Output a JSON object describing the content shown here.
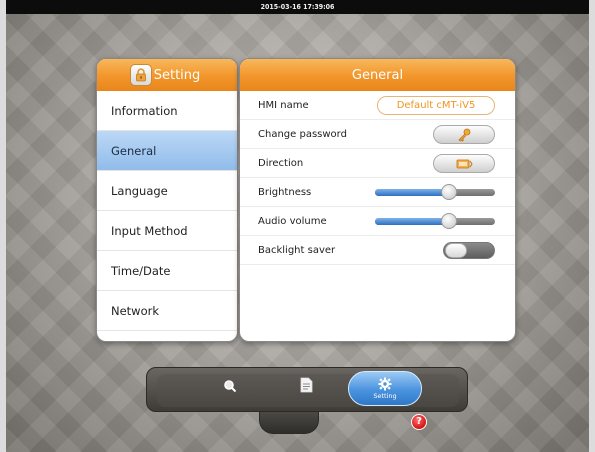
{
  "status_bar": {
    "datetime": "2015-03-16 17:39:06"
  },
  "left_panel": {
    "title": "Setting",
    "items": [
      {
        "label": "Information"
      },
      {
        "label": "General",
        "selected": true
      },
      {
        "label": "Language"
      },
      {
        "label": "Input Method"
      },
      {
        "label": "Time/Date"
      },
      {
        "label": "Network"
      }
    ]
  },
  "right_panel": {
    "title": "General",
    "hmi_name": {
      "label": "HMI name",
      "value": "Default cMT-iV5"
    },
    "change_password": {
      "label": "Change password",
      "icon": "key-icon"
    },
    "direction": {
      "label": "Direction",
      "icon": "rotate-screen-icon"
    },
    "brightness": {
      "label": "Brightness",
      "level_percent": 62
    },
    "audio_volume": {
      "label": "Audio volume",
      "level_percent": 62
    },
    "backlight_saver": {
      "label": "Backlight saver",
      "enabled": false
    }
  },
  "dock": {
    "items": [
      {
        "icon": "search-icon"
      },
      {
        "icon": "document-icon"
      },
      {
        "icon": "gear-icon",
        "label": "Setting",
        "selected": true
      }
    ],
    "help_label": "?"
  },
  "colors": {
    "accent_orange": "#f2952a",
    "selected_blue": "#90bce9",
    "slider_blue": "#2d6fc0",
    "help_red": "#d41414"
  }
}
